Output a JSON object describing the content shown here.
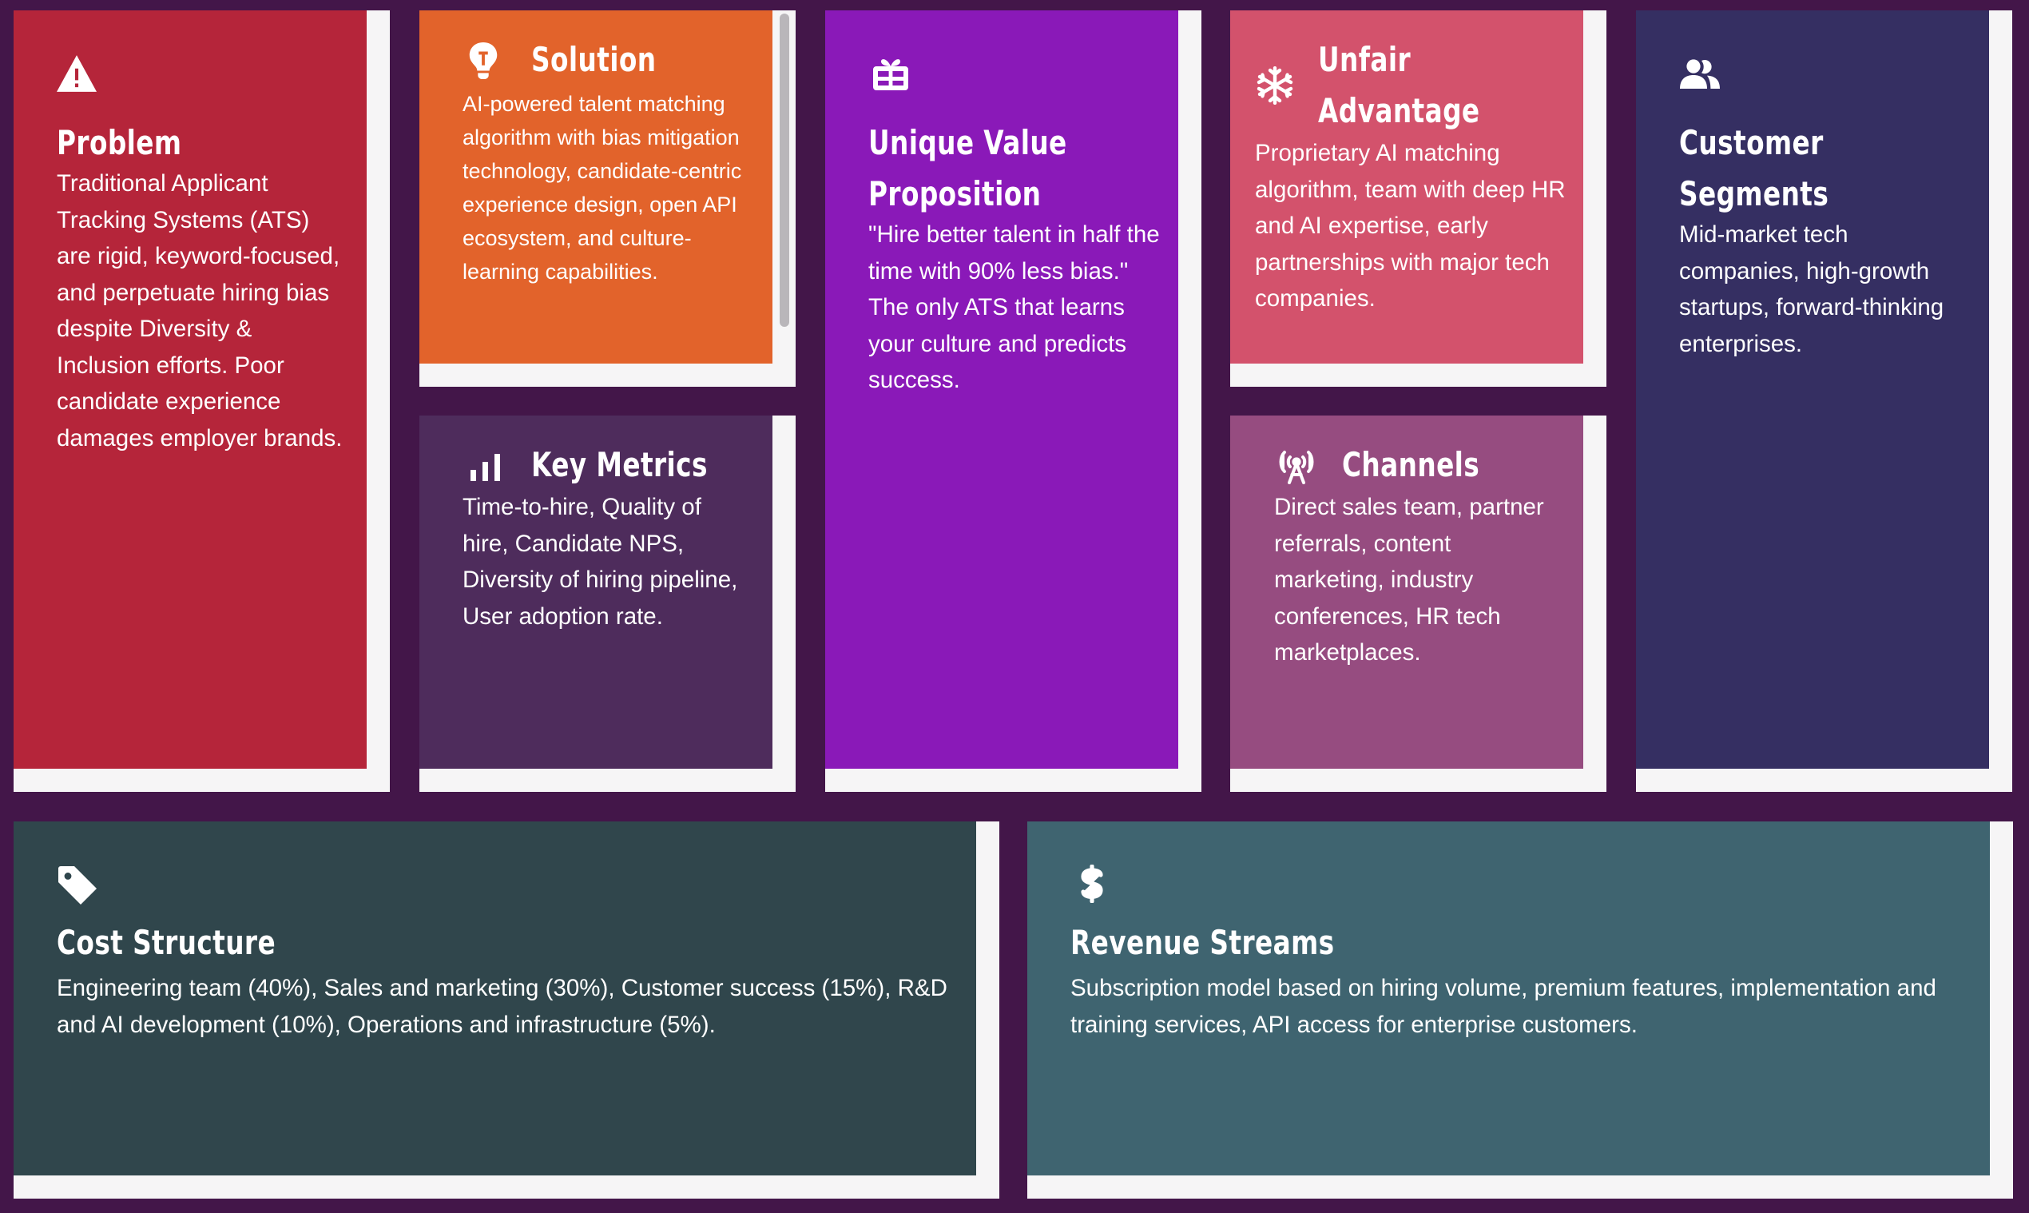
{
  "cards": {
    "problem": {
      "title": "Problem",
      "icon": "warning-icon",
      "color": "#b5253a",
      "text": "Traditional Applicant Tracking Systems (ATS) are rigid, keyword-focused, and perpetuate hiring bias despite Diversity & Inclusion efforts. Poor candidate experience damages employer brands."
    },
    "solution": {
      "title": "Solution",
      "icon": "lightbulb-icon",
      "color": "#e2632b",
      "text": "AI-powered talent matching algorithm with bias mitigation technology, candidate-centric experience design, open API ecosystem, and culture-learning capabilities."
    },
    "key_metrics": {
      "title": "Key Metrics",
      "icon": "bar-chart-icon",
      "color": "#4e2c5c",
      "text": "Time-to-hire, Quality of hire, Candidate NPS, Diversity of hiring pipeline, User adoption rate."
    },
    "uvp": {
      "title": "Unique Value Proposition",
      "icon": "gift-icon",
      "color": "#8a19b8",
      "text": "\"Hire better talent in half the time with 90% less bias.\" The only ATS that learns your culture and predicts success."
    },
    "unfair_advantage": {
      "title": "Unfair Advantage",
      "icon": "snowflake-icon",
      "color": "#d3526c",
      "text": "Proprietary AI matching algorithm, team with deep HR and AI expertise, early partnerships with major tech companies."
    },
    "channels": {
      "title": "Channels",
      "icon": "broadcast-tower-icon",
      "color": "#964c80",
      "text": "Direct sales team, partner referrals, content marketing, industry conferences, HR tech marketplaces."
    },
    "customer_segments": {
      "title": "Customer Segments",
      "icon": "users-icon",
      "color": "#352f62",
      "text": "Mid-market tech companies, high-growth startups, forward-thinking enterprises."
    },
    "cost_structure": {
      "title": "Cost Structure",
      "icon": "tag-icon",
      "color": "#30464c",
      "text": "Engineering team (40%), Sales and marketing (30%), Customer success (15%), R&D and AI development (10%), Operations and infrastructure (5%)."
    },
    "revenue_streams": {
      "title": "Revenue Streams",
      "icon": "dollar-icon",
      "color": "#3f6470",
      "text": "Subscription model based on hiring volume, premium features, implementation and training services, API access for enterprise customers."
    }
  }
}
